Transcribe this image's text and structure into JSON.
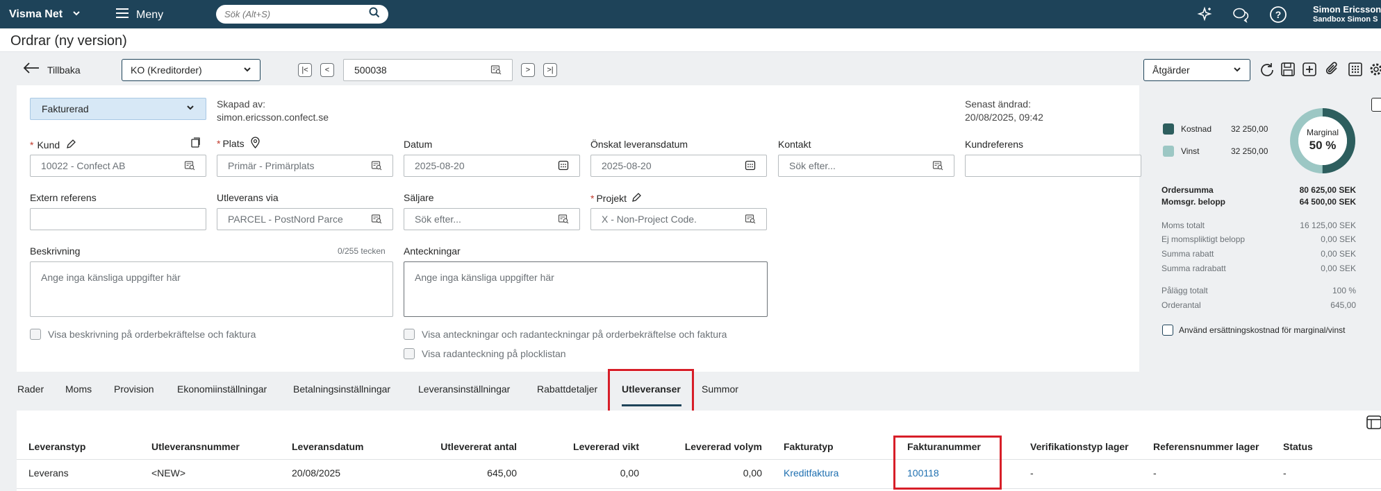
{
  "topbar": {
    "brand": "Visma Net",
    "menu_label": "Meny",
    "search_placeholder": "Sök (Alt+S)",
    "user_name": "Simon Ericsson",
    "user_company": "Sandbox Simon S"
  },
  "page": {
    "title": "Ordrar (ny version)"
  },
  "toolbar": {
    "back_label": "Tillbaka",
    "order_type": "KO (Kreditorder)",
    "order_number": "500038",
    "actions_label": "Åtgärder"
  },
  "header": {
    "status": "Fakturerad",
    "created_by_label": "Skapad av:",
    "created_by_value": "simon.ericsson.confect.se",
    "last_changed_label": "Senast ändrad:",
    "last_changed_value": "20/08/2025, 09:42"
  },
  "fields": {
    "customer_label": "Kund",
    "customer_value": "10022 - Confect AB",
    "location_label": "Plats",
    "location_value": "Primär - Primärplats",
    "date_label": "Datum",
    "date_value": "2025-08-20",
    "requested_date_label": "Önskat leveransdatum",
    "requested_date_value": "2025-08-20",
    "contact_label": "Kontakt",
    "contact_placeholder": "Sök efter...",
    "customer_ref_label": "Kundreferens",
    "external_ref_label": "Extern referens",
    "ship_via_label": "Utleverans via",
    "ship_via_value": "PARCEL - PostNord Parce",
    "salesperson_label": "Säljare",
    "salesperson_placeholder": "Sök efter...",
    "project_label": "Projekt",
    "project_value": "X - Non-Project Code.",
    "description_label": "Beskrivning",
    "description_counter": "0/255 tecken",
    "description_placeholder": "Ange inga känsliga uppgifter här",
    "notes_label": "Anteckningar",
    "notes_placeholder": "Ange inga känsliga uppgifter här",
    "chk_show_description": "Visa beskrivning på orderbekräftelse och faktura",
    "chk_show_notes": "Visa anteckningar och radanteckningar på orderbekräftelse och faktura",
    "chk_show_line_notes": "Visa radanteckning på plocklistan"
  },
  "summary": {
    "cost_label": "Kostnad",
    "cost_value": "32 250,00",
    "profit_label": "Vinst",
    "profit_value": "32 250,00",
    "margin_label": "Marginal",
    "margin_value": "50 %",
    "margin_fraction": 0.5,
    "order_total_label": "Ordersumma",
    "order_total_value": "80 625,00 SEK",
    "vat_taxable_label": "Momsgr. belopp",
    "vat_taxable_value": "64 500,00 SEK",
    "vat_total_label": "Moms totalt",
    "vat_total_value": "16 125,00 SEK",
    "vat_exempt_label": "Ej momspliktigt belopp",
    "vat_exempt_value": "0,00 SEK",
    "discount_label": "Summa rabatt",
    "discount_value": "0,00 SEK",
    "line_discount_label": "Summa radrabatt",
    "line_discount_value": "0,00 SEK",
    "markup_label": "Pålägg totalt",
    "markup_value": "100 %",
    "order_qty_label": "Orderantal",
    "order_qty_value": "645,00",
    "replacement_cost_label": "Använd ersättningskostnad för marginal/vinst"
  },
  "tabs": [
    "Rader",
    "Moms",
    "Provision",
    "Ekonomiinställningar",
    "Betalningsinställningar",
    "Leveransinställningar",
    "Rabattdetaljer",
    "Utleveranser",
    "Summor"
  ],
  "table": {
    "columns": [
      "Leveranstyp",
      "Utleveransnummer",
      "Leveransdatum",
      "Utlevererat antal",
      "Levererad vikt",
      "Levererad volym",
      "Fakturatyp",
      "Fakturanummer",
      "Verifikationstyp lager",
      "Referensnummer lager",
      "Status"
    ],
    "rows": [
      [
        "Leverans",
        "<NEW>",
        "20/08/2025",
        "645,00",
        "0,00",
        "0,00",
        "Kreditfaktura",
        "100118",
        "-",
        "-",
        "-"
      ]
    ]
  },
  "colors": {
    "topbar": "#1e4359",
    "cost_swatch": "#2d5e5e",
    "profit_swatch": "#9cc7c4",
    "highlight": "#d71e28"
  }
}
